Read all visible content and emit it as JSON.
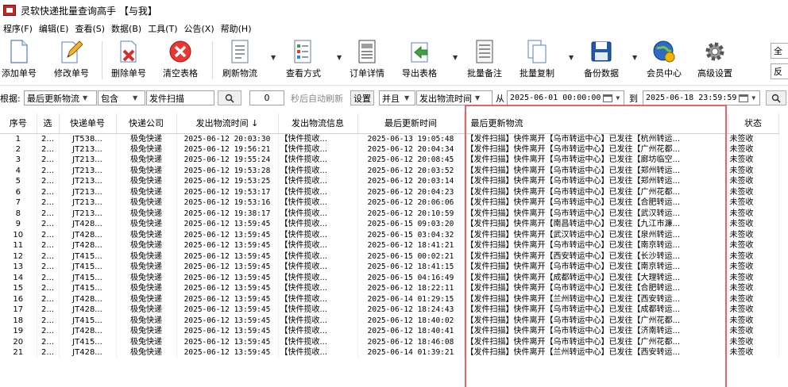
{
  "window": {
    "title": "灵软快递批量查询高手 【与我】"
  },
  "menu": [
    "程序(F)",
    "编辑(E)",
    "查看(S)",
    "数据(B)",
    "工具(T)",
    "公告(X)",
    "帮助(H)"
  ],
  "toolbar": {
    "add": "添加单号",
    "edit": "修改单号",
    "delete": "删除单号",
    "clear": "清空表格",
    "refresh": "刷新物流",
    "view": "查看方式",
    "detail": "订单详情",
    "export": "导出表格",
    "note": "批量备注",
    "copy": "批量复制",
    "backup": "备份数据",
    "member": "会员中心",
    "settings": "高级设置",
    "right1": "全",
    "right2": "反"
  },
  "filter": {
    "label": "根据:",
    "field": "最后更新物流",
    "op": "包含",
    "value": "发件扫描",
    "count": "0",
    "auto_refresh": "秒后自动刷新",
    "set": "设置",
    "logic": "并且",
    "time_field": "发出物流时间",
    "from": "从",
    "from_date": "2025-06-01 00:00:00",
    "to": "到",
    "to_date": "2025-06-18 23:59:59"
  },
  "table": {
    "headers": [
      "序号",
      "选",
      "快递单号",
      "快递公司",
      "发出物流时间 ↓",
      "发出物流信息",
      "最后更新时间",
      "最后更新物流",
      "状态"
    ],
    "rows": [
      [
        "1",
        "2...",
        "JT538...",
        "极兔快递",
        "2025-06-12 20:03:30",
        "【快件揽收...",
        "2025-06-13 19:05:48",
        "【发件扫描】快件离开【乌市转运中心】已发往【杭州转运...",
        "未签收"
      ],
      [
        "2",
        "2...",
        "JT213...",
        "极兔快递",
        "2025-06-12 19:56:21",
        "【快件揽收...",
        "2025-06-12 20:04:34",
        "【发件扫描】快件离开【乌市转运中心】已发往【广州花都...",
        "未签收"
      ],
      [
        "3",
        "2...",
        "JT213...",
        "极兔快递",
        "2025-06-12 19:55:24",
        "【快件揽收...",
        "2025-06-12 20:08:45",
        "【发件扫描】快件离开【乌市转运中心】已发往【廊坊临空...",
        "未签收"
      ],
      [
        "4",
        "2...",
        "JT213...",
        "极兔快递",
        "2025-06-12 19:53:28",
        "【快件揽收...",
        "2025-06-12 20:03:52",
        "【发件扫描】快件离开【乌市转运中心】已发往【郑州转运...",
        "未签收"
      ],
      [
        "5",
        "2...",
        "JT213...",
        "极兔快递",
        "2025-06-12 19:53:25",
        "【快件揽收...",
        "2025-06-12 20:03:14",
        "【发件扫描】快件离开【乌市转运中心】已发往【郑州转运...",
        "未签收"
      ],
      [
        "6",
        "2...",
        "JT213...",
        "极兔快递",
        "2025-06-12 19:53:17",
        "【快件揽收...",
        "2025-06-12 20:04:23",
        "【发件扫描】快件离开【乌市转运中心】已发往【广州花都...",
        "未签收"
      ],
      [
        "7",
        "2...",
        "JT213...",
        "极兔快递",
        "2025-06-12 19:53:16",
        "【快件揽收...",
        "2025-06-12 20:06:06",
        "【发件扫描】快件离开【乌市转运中心】已发往【合肥转运...",
        "未签收"
      ],
      [
        "8",
        "2...",
        "JT213...",
        "极兔快递",
        "2025-06-12 19:38:17",
        "【快件揽收...",
        "2025-06-12 20:10:59",
        "【发件扫描】快件离开【乌市转运中心】已发往【武汉转运...",
        "未签收"
      ],
      [
        "9",
        "2...",
        "JT428...",
        "极兔快递",
        "2025-06-12 13:59:45",
        "【快件揽收...",
        "2025-06-15 09:03:20",
        "【发件扫描】快件离开【南昌转运中心】已发往【九江市濂...",
        "未签收"
      ],
      [
        "10",
        "2...",
        "JT428...",
        "极兔快递",
        "2025-06-12 13:59:45",
        "【快件揽收...",
        "2025-06-15 03:04:32",
        "【发件扫描】快件离开【武汉转运中心】已发往【泉州转运...",
        "未签收"
      ],
      [
        "11",
        "2...",
        "JT428...",
        "极兔快递",
        "2025-06-12 13:59:45",
        "【快件揽收...",
        "2025-06-12 18:41:21",
        "【发件扫描】快件离开【乌市转运中心】已发往【南京转运...",
        "未签收"
      ],
      [
        "12",
        "2...",
        "JT415...",
        "极兔快递",
        "2025-06-12 13:59:45",
        "【快件揽收...",
        "2025-06-15 00:02:21",
        "【发件扫描】快件离开【西安转运中心】已发往【长沙转运...",
        "未签收"
      ],
      [
        "13",
        "2...",
        "JT415...",
        "极兔快递",
        "2025-06-12 13:59:45",
        "【快件揽收...",
        "2025-06-12 18:41:15",
        "【发件扫描】快件离开【乌市转运中心】已发往【南京转运...",
        "未签收"
      ],
      [
        "14",
        "2...",
        "JT415...",
        "极兔快递",
        "2025-06-12 13:59:45",
        "【快件揽收...",
        "2025-06-15 04:16:49",
        "【发件扫描】快件离开【成都转运中心】已发往【大理转运...",
        "未签收"
      ],
      [
        "15",
        "2...",
        "JT415...",
        "极兔快递",
        "2025-06-12 13:59:45",
        "【快件揽收...",
        "2025-06-12 18:22:11",
        "【发件扫描】快件离开【乌市转运中心】已发往【合肥转运...",
        "未签收"
      ],
      [
        "16",
        "2...",
        "JT428...",
        "极兔快递",
        "2025-06-12 13:59:45",
        "【快件揽收...",
        "2025-06-14 01:29:15",
        "【发件扫描】快件离开【兰州转运中心】已发往【西安转运...",
        "未签收"
      ],
      [
        "17",
        "2...",
        "JT428...",
        "极兔快递",
        "2025-06-12 13:59:45",
        "【快件揽收...",
        "2025-06-12 18:24:43",
        "【发件扫描】快件离开【乌市转运中心】已发往【成都转运...",
        "未签收"
      ],
      [
        "18",
        "2...",
        "JT415...",
        "极兔快递",
        "2025-06-12 13:59:45",
        "【快件揽收...",
        "2025-06-12 18:40:02",
        "【发件扫描】快件离开【乌市转运中心】已发往【广州花都...",
        "未签收"
      ],
      [
        "19",
        "2...",
        "JT428...",
        "极兔快递",
        "2025-06-12 13:59:45",
        "【快件揽收...",
        "2025-06-12 18:40:41",
        "【发件扫描】快件离开【乌市转运中心】已发往【济南转运...",
        "未签收"
      ],
      [
        "20",
        "2...",
        "JT415...",
        "极兔快递",
        "2025-06-12 13:59:45",
        "【快件揽收...",
        "2025-06-12 18:46:08",
        "【发件扫描】快件离开【乌市转运中心】已发往【广州花都...",
        "未签收"
      ],
      [
        "21",
        "2...",
        "JT428...",
        "极兔快递",
        "2025-06-12 13:59:45",
        "【快件揽收...",
        "2025-06-14 01:39:21",
        "【发件扫描】快件离开【兰州转运中心】已发往【西安转运...",
        "未签收"
      ]
    ]
  },
  "colors": {
    "highlight": "#e5646b",
    "accent": "#c62828"
  }
}
